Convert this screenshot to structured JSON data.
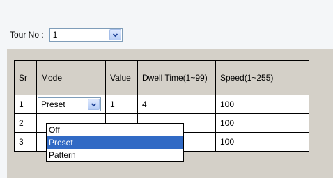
{
  "tour": {
    "label": "Tour No :",
    "selected": "1"
  },
  "table": {
    "headers": {
      "sr": "Sr",
      "mode": "Mode",
      "value": "Value",
      "dwell": "Dwell Time(1~99)",
      "speed": "Speed(1~255)"
    },
    "rows": [
      {
        "sr": "1",
        "mode": "Preset",
        "value": "1",
        "dwell": "4",
        "speed": "100"
      },
      {
        "sr": "2",
        "speed": "100"
      },
      {
        "sr": "3",
        "speed": "100"
      }
    ]
  },
  "mode_dropdown": {
    "options": [
      "Off",
      "Preset",
      "Pattern"
    ],
    "selected": "Preset"
  },
  "colors": {
    "selection": "#316ac5",
    "header_bg": "#d4d0c8",
    "page_bg": "#f4f6f8"
  }
}
